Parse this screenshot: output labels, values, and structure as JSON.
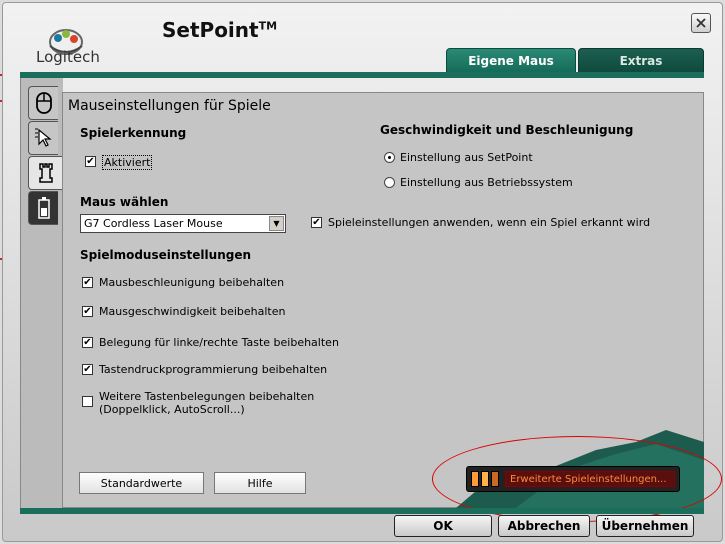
{
  "app": {
    "brand": "Logitech",
    "title": "SetPoint",
    "trademark": "TM"
  },
  "tabs": [
    {
      "label": "Eigene Maus",
      "active": true
    },
    {
      "label": "Extras",
      "active": false
    }
  ],
  "side_tabs": [
    {
      "icon": "mouse-icon"
    },
    {
      "icon": "pointer-icon"
    },
    {
      "icon": "chess-rook-icon",
      "active": true
    },
    {
      "icon": "battery-icon"
    }
  ],
  "page": {
    "heading": "Mauseinstellungen für Spiele",
    "detection": {
      "title": "Spielerkennung",
      "enabled_label": "Aktiviert",
      "enabled": true
    },
    "speed": {
      "title": "Geschwindigkeit und Beschleunigung",
      "options": [
        {
          "label": "Einstellung aus SetPoint",
          "selected": true
        },
        {
          "label": "Einstellung aus Betriebssystem",
          "selected": false
        }
      ]
    },
    "mouse_select": {
      "title": "Maus wählen",
      "value": "G7 Cordless Laser Mouse"
    },
    "apply_game": {
      "label": "Spieleinstellungen anwenden, wenn ein Spiel erkannt wird",
      "checked": true
    },
    "modes": {
      "title": "Spielmoduseinstellungen",
      "items": [
        {
          "label": "Mausbeschleunigung beibehalten",
          "checked": true
        },
        {
          "label": "Mausgeschwindigkeit beibehalten",
          "checked": true
        },
        {
          "label": "Belegung für linke/rechte Taste beibehalten",
          "checked": true
        },
        {
          "label": "Tastendruckprogrammierung beibehalten",
          "checked": true
        },
        {
          "label": "Weitere Tastenbelegungen beibehalten (Doppelklick, AutoScroll...)",
          "checked": false
        }
      ]
    },
    "defaults_button": "Standardwerte",
    "help_button": "Hilfe",
    "advanced_button": "Erweiterte Spieleinstellungen..."
  },
  "footer": {
    "ok": "OK",
    "cancel": "Abbrechen",
    "apply": "Übernehmen"
  },
  "colors": {
    "tab_active": "#1f7a66",
    "advanced_text": "#ff8a3a",
    "highlight_ellipse": "#dd0000"
  }
}
